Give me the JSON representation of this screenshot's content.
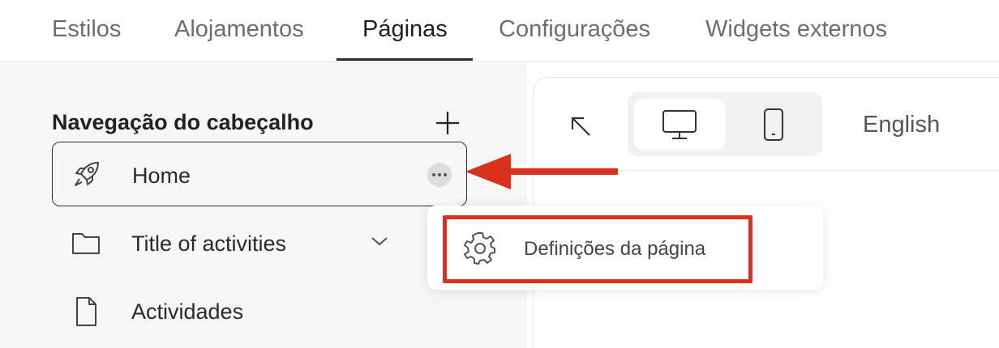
{
  "tabs": [
    {
      "label": "Estilos",
      "active": false
    },
    {
      "label": "Alojamentos",
      "active": false
    },
    {
      "label": "Páginas",
      "active": true
    },
    {
      "label": "Configurações",
      "active": false
    },
    {
      "label": "Widgets externos",
      "active": false
    }
  ],
  "sidebar": {
    "heading": "Navegação do cabeçalho",
    "items": [
      {
        "label": "Home",
        "icon": "rocket-icon",
        "selected": true
      },
      {
        "label": "Title of activities",
        "icon": "folder-icon",
        "expandable": true
      },
      {
        "label": "Actividades",
        "icon": "page-icon"
      }
    ]
  },
  "preview": {
    "language": "English",
    "devices": [
      "desktop-icon",
      "mobile-icon"
    ],
    "selected_device": "desktop"
  },
  "context_menu": {
    "items": [
      {
        "label": "Definições da página",
        "icon": "gear-icon"
      }
    ]
  },
  "colors": {
    "annotation": "#d9311b",
    "sidebar_bg": "#f6f6f6",
    "active_tab": "#1f1f1f"
  }
}
